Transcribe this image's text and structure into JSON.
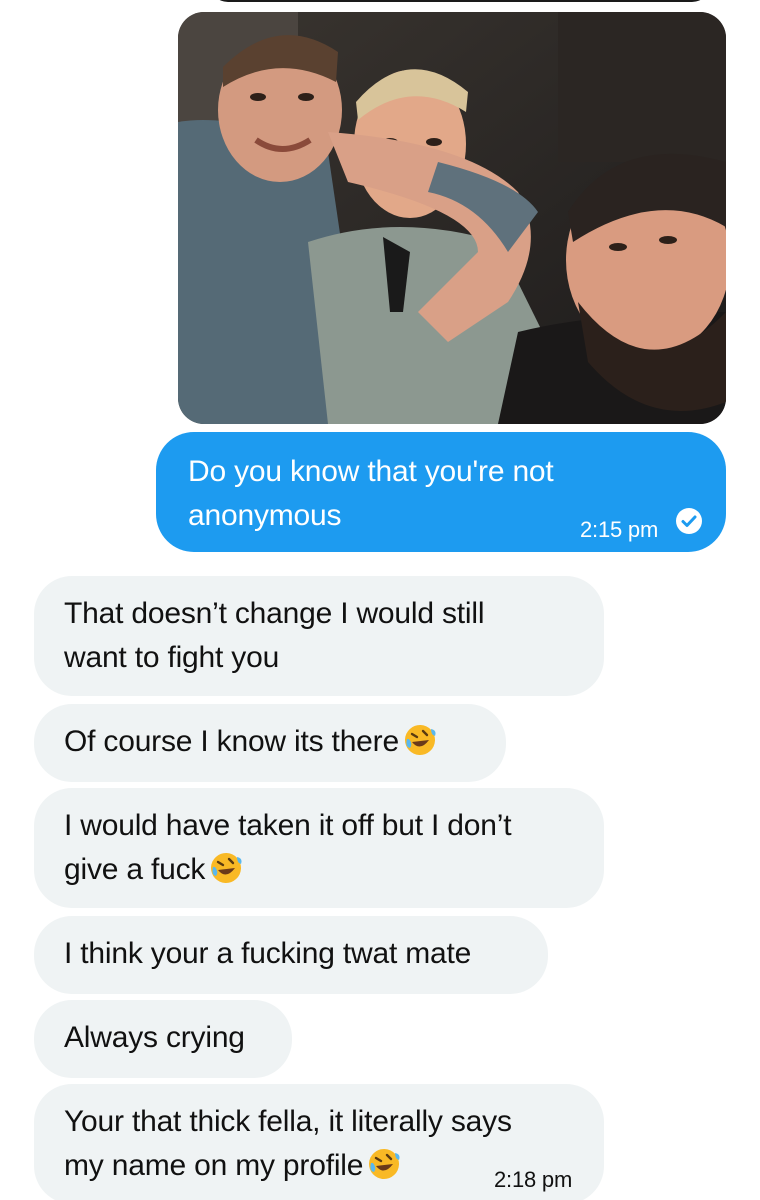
{
  "photo": {
    "description_icon": "group-selfie-photo"
  },
  "sent_message": {
    "line1": "Do you know that you're not",
    "line2": "anonymous",
    "time": "2:15 pm",
    "status_icon": "read-check-icon",
    "color": "#1d9bf0"
  },
  "received": [
    {
      "line1": "That doesn’t change I would still",
      "line2": "want to fight you"
    },
    {
      "line1": "Of course I know its there",
      "emoji": "rolling-on-floor-laughing-emoji"
    },
    {
      "line1": "I would have taken it off but I don’t",
      "line2": "give a fuck",
      "emoji": "rolling-on-floor-laughing-emoji"
    },
    {
      "line1": "I think your a fucking twat mate"
    },
    {
      "line1": "Always crying"
    },
    {
      "line1": "Your that thick fella, it literally says",
      "line2": "my name on my profile",
      "emoji": "rolling-on-floor-laughing-emoji",
      "time": "2:18 pm"
    }
  ],
  "colors": {
    "received_bubble": "#eff3f4",
    "text": "#111111"
  }
}
